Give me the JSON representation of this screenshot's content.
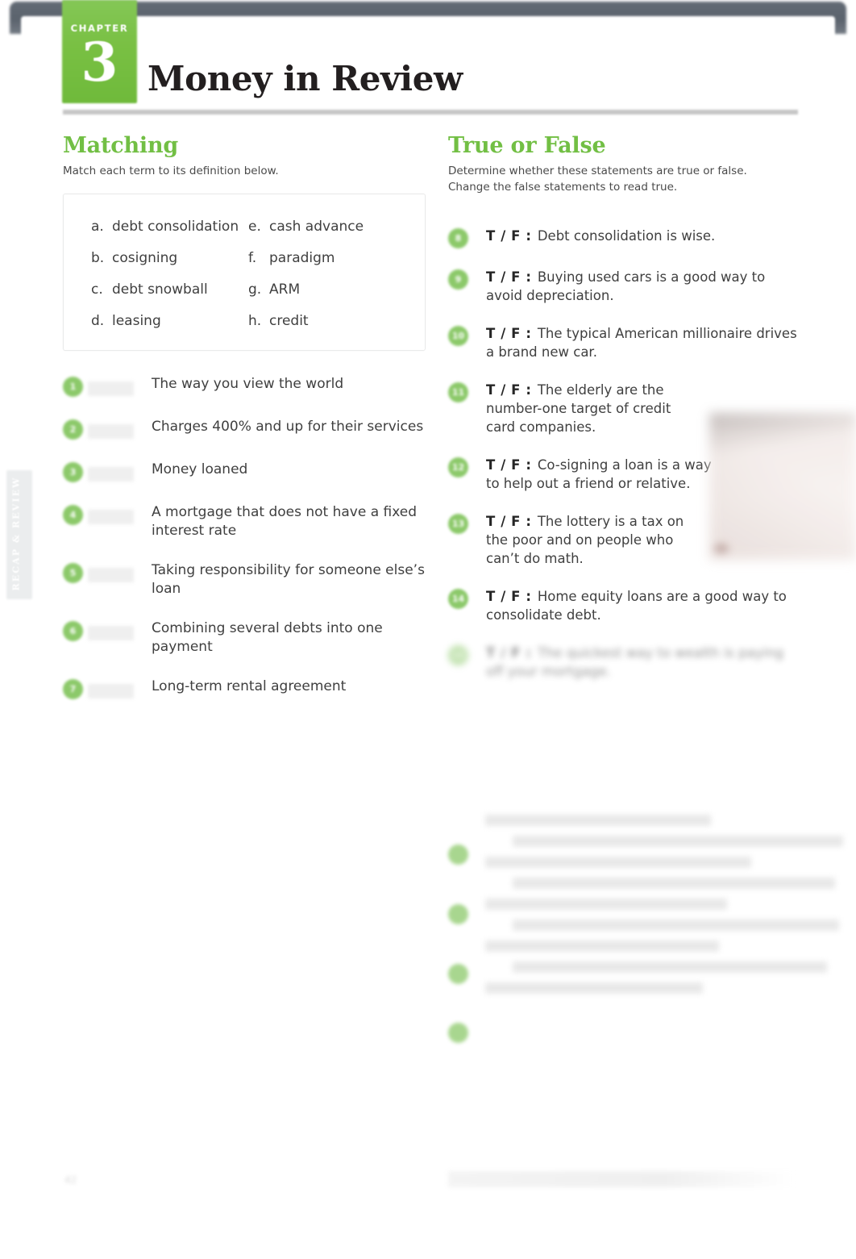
{
  "document": {
    "chapter_word": "CHAPTER",
    "chapter_number": "3",
    "title": "Money in Review",
    "side_tab_label": "RECAP & REVIEW",
    "page_number": "42",
    "accent_green": "#72bf44",
    "badge_green": "#8cc96a",
    "top_bar_color": "#5d6570",
    "rule_color": "#c6c6c6",
    "text_color": "#3f3f3f"
  },
  "matching": {
    "heading": "Matching",
    "instruction": "Match each term to its definition below.",
    "terms": [
      {
        "letter": "a.",
        "label": "debt consolidation"
      },
      {
        "letter": "e.",
        "label": "cash advance"
      },
      {
        "letter": "b.",
        "label": "cosigning"
      },
      {
        "letter": "f.",
        "label": "paradigm"
      },
      {
        "letter": "c.",
        "label": "debt snowball"
      },
      {
        "letter": "g.",
        "label": "ARM"
      },
      {
        "letter": "d.",
        "label": "leasing"
      },
      {
        "letter": "h.",
        "label": "credit"
      }
    ],
    "items": [
      {
        "number": "1",
        "text": "The way you view the world"
      },
      {
        "number": "2",
        "text": "Charges 400% and up for their services"
      },
      {
        "number": "3",
        "text": "Money loaned"
      },
      {
        "number": "4",
        "text": "A mortgage that does not have a fixed interest rate"
      },
      {
        "number": "5",
        "text": "Taking responsibility for someone else’s loan"
      },
      {
        "number": "6",
        "text": "Combining several debts into one payment"
      },
      {
        "number": "7",
        "text": "Long-term rental agreement"
      }
    ]
  },
  "true_or_false": {
    "heading": "True or False",
    "instruction_line1": "Determine whether these statements are true or false.",
    "instruction_line2": "Change the false statements to read true.",
    "prefix": "T / F :",
    "items": [
      {
        "number": "8",
        "text": "Debt consolidation is wise.",
        "width": "tf-w-full",
        "obscured": false
      },
      {
        "number": "9",
        "text": "Buying used cars is a good way to avoid depreciation.",
        "width": "tf-w-full",
        "obscured": false
      },
      {
        "number": "10",
        "text": "The typical American millionaire drives a brand new car.",
        "width": "tf-w-full",
        "obscured": false
      },
      {
        "number": "11",
        "text": "The elderly are the number-one target of credit card companies.",
        "width": "tf-w-short",
        "obscured": false
      },
      {
        "number": "12",
        "text": "Co-signing a loan is a way to help out a friend or relative.",
        "width": "tf-w-mid",
        "obscured": false
      },
      {
        "number": "13",
        "text": "The lottery is a tax on the poor and on people who can’t do math.",
        "width": "tf-w-short",
        "obscured": false
      },
      {
        "number": "14",
        "text": "Home equity loans are a good way to consolidate debt.",
        "width": "tf-w-full",
        "obscured": false
      },
      {
        "number": "15",
        "text": "The quickest way to wealth is paying off your mortgage.",
        "width": "tf-w-full",
        "obscured": true
      }
    ]
  }
}
